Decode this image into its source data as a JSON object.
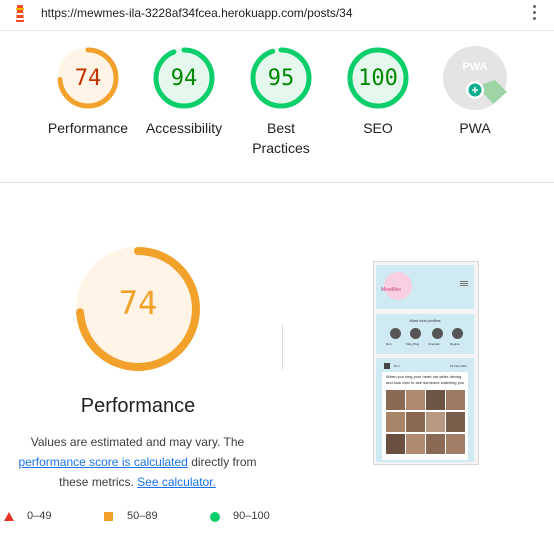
{
  "browser": {
    "url": "https://mewmes-ila-3228af34fcea.herokuapp.com/posts/34"
  },
  "summary_gauges": [
    {
      "label": "Performance",
      "score": "74",
      "value": 74,
      "color": "#f2a12b",
      "fill": "#fff4e5",
      "text_color": "#c33300"
    },
    {
      "label": "Accessibility",
      "score": "94",
      "value": 94,
      "color": "#0cce6b",
      "fill": "#e5f8ee",
      "text_color": "#008800"
    },
    {
      "label": "Best Practices",
      "score": "95",
      "value": 95,
      "color": "#0cce6b",
      "fill": "#e5f8ee",
      "text_color": "#008800"
    },
    {
      "label": "SEO",
      "score": "100",
      "value": 100,
      "color": "#0cce6b",
      "fill": "#e5f8ee",
      "text_color": "#008800"
    },
    {
      "label": "PWA",
      "badge": "PWA"
    }
  ],
  "performance": {
    "score": "74",
    "value": 74,
    "title": "Performance",
    "desc_pre": "Values are estimated and may vary. The ",
    "link1": "performance score is calculated",
    "desc_mid": " directly from these metrics. ",
    "link2": "See calculator."
  },
  "legend": {
    "fail": "0–49",
    "average": "50–89",
    "pass": "90–100"
  },
  "screenshot": {
    "logo_text": "MewMes",
    "profiles_title": "Most viral profiles",
    "profiles": [
      "Ron",
      "Mila_Blog",
      "Chandler",
      "Regina"
    ],
    "post_user": "Ron",
    "post_date": "04 Feb 2024",
    "caption": "When you sing your heart out while driving and look over to see someone watching you"
  },
  "colors": {
    "fail": "#eb3324",
    "average": "#f2a12b",
    "pass": "#0cce6b",
    "link": "#1a73e8"
  }
}
